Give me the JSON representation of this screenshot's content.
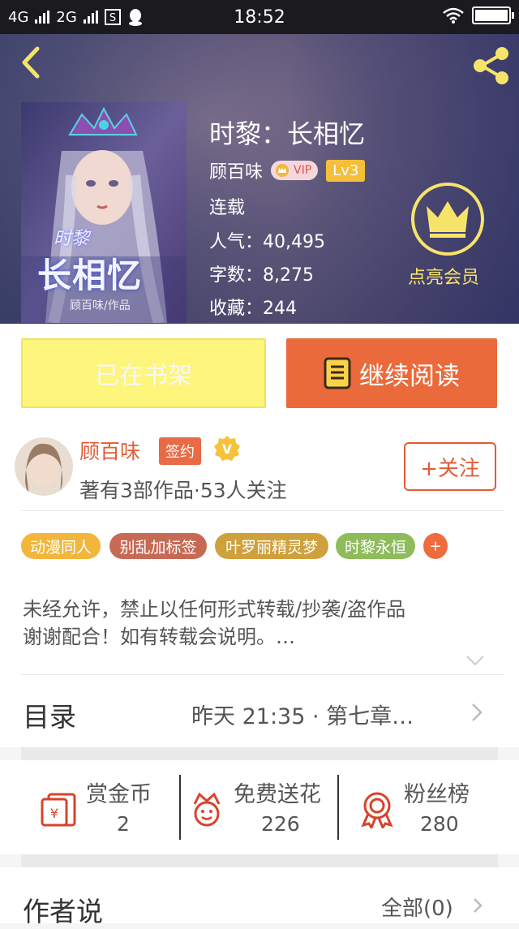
{
  "status_bar": {
    "network1": "4G",
    "network2": "2G",
    "time": "18:52"
  },
  "book": {
    "title": "时黎：长相忆",
    "cover_text": "时黎",
    "cover_title": "长相忆",
    "cover_author": "顾百味/作品",
    "author": "顾百味",
    "vip": "VIP",
    "level": "Lv3",
    "status": "连载",
    "popularity": "人气：40,495",
    "words": "字数：8,275",
    "favorites": "收藏：244",
    "member_label": "点亮会员"
  },
  "actions": {
    "shelf_label": "已在书架",
    "read_label": "继续阅读"
  },
  "author_block": {
    "name": "顾百味",
    "signed": "签约",
    "stats": "著有3部作品·53人关注",
    "follow": "+关注"
  },
  "tags": [
    "动漫同人",
    "别乱加标签",
    "叶罗丽精灵梦",
    "时黎永恒",
    "+"
  ],
  "tag_colors": [
    "#f2b63c",
    "#c76a55",
    "#cfa13c",
    "#8fbc5a",
    "#ef6a3d"
  ],
  "description": {
    "line1": "未经允许，禁止以任何形式转载/抄袭/盗作品",
    "line2": "谢谢配合！如有转载会说明。…"
  },
  "toc": {
    "label": "目录",
    "latest": "昨天 21:35 · 第七章…"
  },
  "stats": {
    "coins_label": "赏金币",
    "coins": "2",
    "flowers_label": "免费送花",
    "flowers": "226",
    "fans_label": "粉丝榜",
    "fans": "280"
  },
  "author_said": {
    "label": "作者说",
    "all": "全部(0)"
  },
  "colors": {
    "accent": "#ea6a3b",
    "shelf": "#fdf57c",
    "member": "#f6e46a"
  }
}
